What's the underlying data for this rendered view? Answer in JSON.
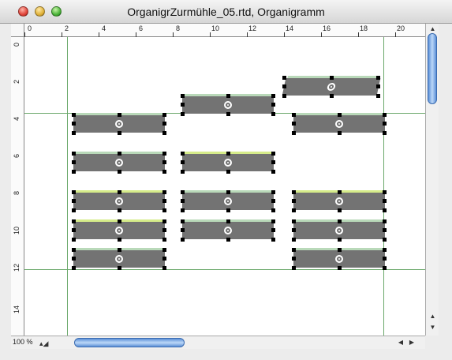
{
  "window": {
    "title": "OrganigrZurmühle_05.rtd, Organigramm"
  },
  "ruler": {
    "h_labels": [
      "0",
      "2",
      "4",
      "6",
      "8",
      "10",
      "12",
      "14",
      "16",
      "18",
      "20"
    ],
    "v_labels": [
      "0",
      "2",
      "4",
      "6",
      "8",
      "10",
      "12",
      "14"
    ]
  },
  "status": {
    "zoom": "100 %"
  },
  "colors": {
    "box_fill": "#737373",
    "guide": "#6aa86a",
    "scroll_accent": "#5b8fd6"
  },
  "icons": {
    "close": "close-icon",
    "minimize": "minimize-icon",
    "zoom": "zoom-icon",
    "scroll_up": "arrow-up-icon",
    "scroll_down": "arrow-down-icon",
    "scroll_left": "arrow-left-icon",
    "scroll_right": "arrow-right-icon"
  }
}
